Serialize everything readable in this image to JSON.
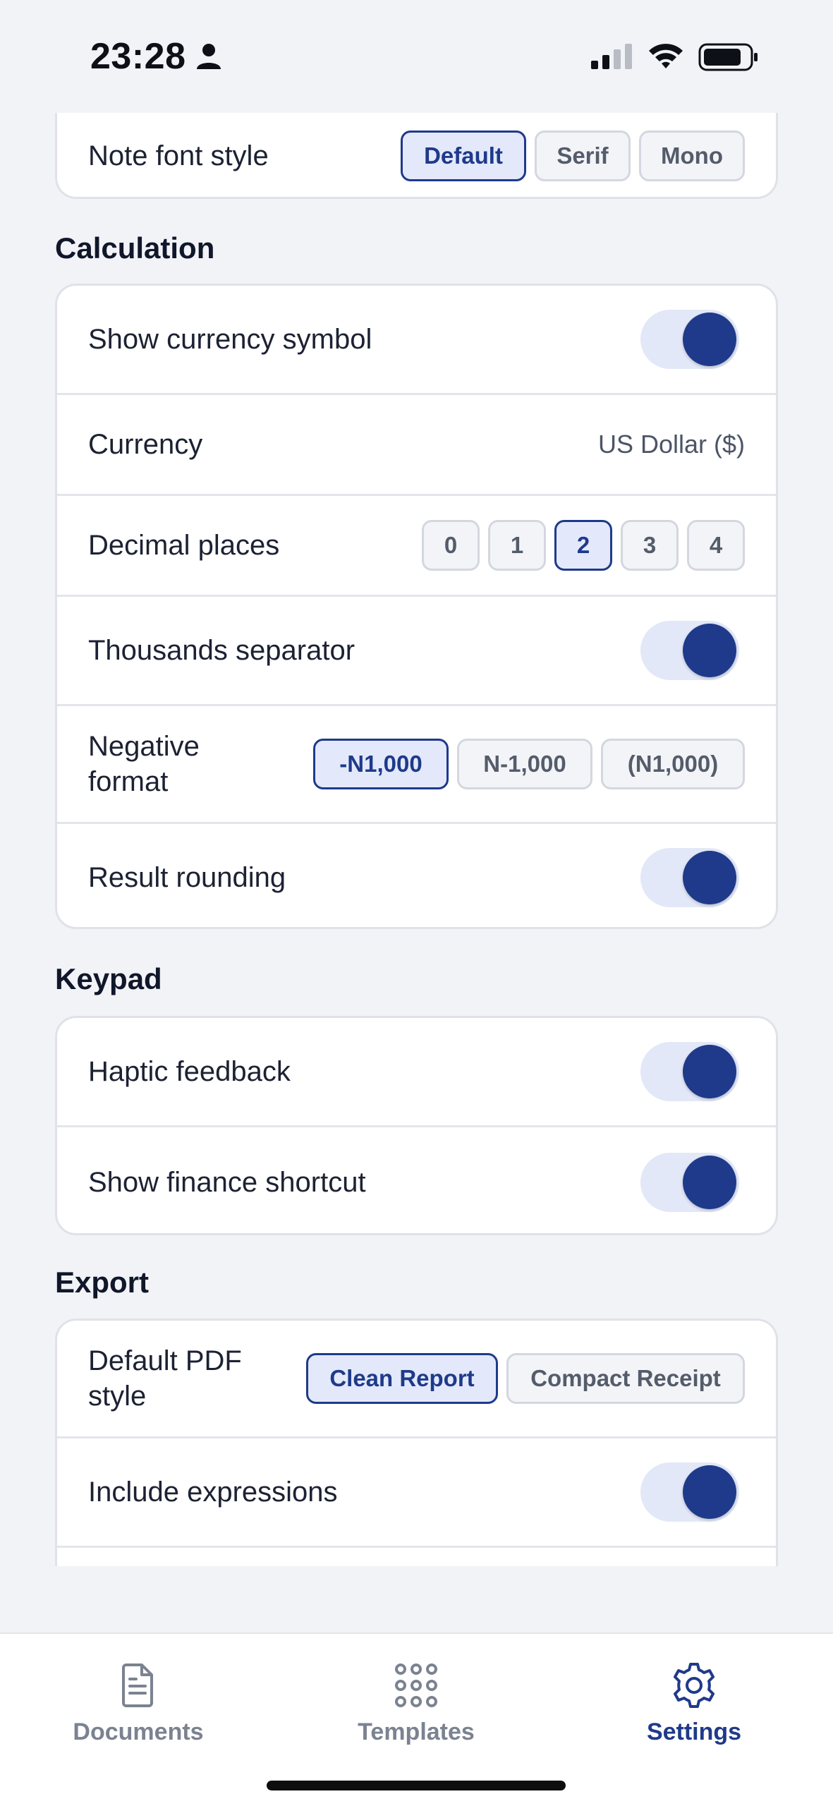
{
  "status_bar": {
    "time": "23:28"
  },
  "appearance": {
    "note_font_style": {
      "label": "Note font style",
      "options": [
        "Default",
        "Serif",
        "Mono"
      ],
      "selected": "Default"
    }
  },
  "calculation": {
    "title": "Calculation",
    "show_currency_symbol": {
      "label": "Show currency symbol",
      "on": true
    },
    "currency": {
      "label": "Currency",
      "value": "US Dollar ($)"
    },
    "decimal_places": {
      "label": "Decimal places",
      "options": [
        "0",
        "1",
        "2",
        "3",
        "4"
      ],
      "selected": "2"
    },
    "thousands_separator": {
      "label": "Thousands separator",
      "on": true
    },
    "negative_format": {
      "label": "Negative format",
      "options": [
        "-N1,000",
        "N-1,000",
        "(N1,000)"
      ],
      "selected": "-N1,000"
    },
    "result_rounding": {
      "label": "Result rounding",
      "on": true
    }
  },
  "keypad": {
    "title": "Keypad",
    "haptic_feedback": {
      "label": "Haptic feedback",
      "on": true
    },
    "show_finance_shortcut": {
      "label": "Show finance shortcut",
      "on": true
    }
  },
  "export": {
    "title": "Export",
    "default_pdf_style": {
      "label": "Default PDF style",
      "options": [
        "Clean Report",
        "Compact Receipt"
      ],
      "selected": "Clean Report"
    },
    "include_expressions": {
      "label": "Include expressions",
      "on": true
    }
  },
  "tab_bar": {
    "tabs": [
      {
        "label": "Documents",
        "icon": "document-icon",
        "active": false
      },
      {
        "label": "Templates",
        "icon": "grid-icon",
        "active": false
      },
      {
        "label": "Settings",
        "icon": "gear-icon",
        "active": true
      }
    ]
  },
  "colors": {
    "accent": "#1f3a8a",
    "accent_bg": "#e3e9fb",
    "background": "#f2f3f7",
    "card": "#ffffff"
  }
}
